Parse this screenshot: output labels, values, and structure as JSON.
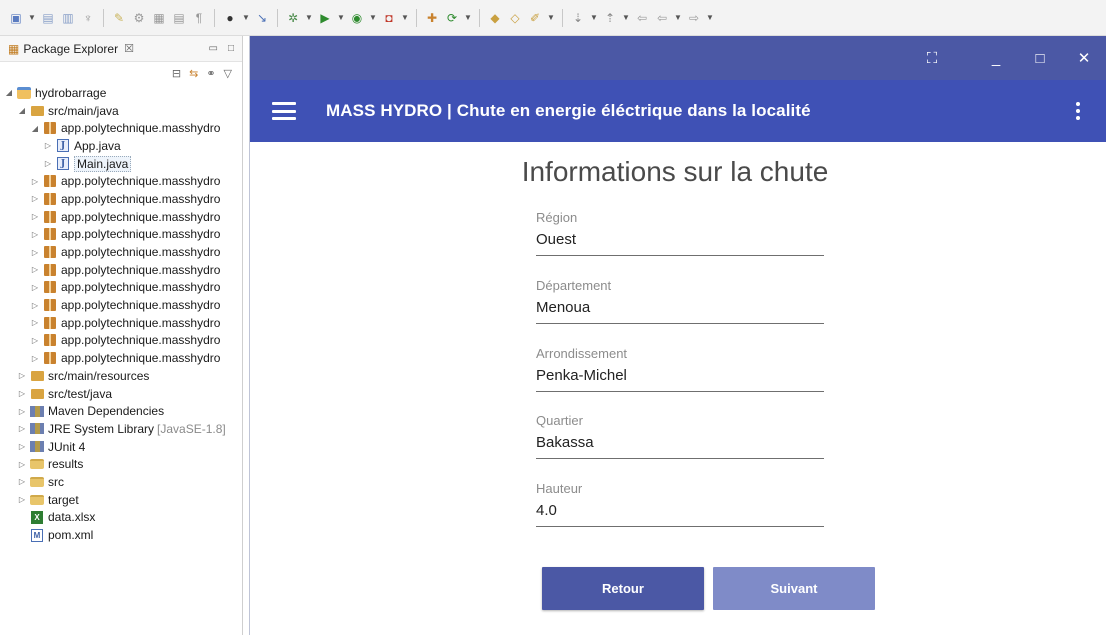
{
  "toolbar": {
    "icons": [
      "new-icon",
      "save-icon",
      "save-all-icon",
      "pin-icon",
      "edit-icon",
      "debug-icon",
      "terminal-icon",
      "doc-icon",
      "paragraph-icon",
      "profile-icon",
      "link-icon",
      "bug-icon",
      "run-icon",
      "coverage-icon",
      "external-tools-icon",
      "new-java-icon",
      "refresh-icon",
      "open-icon",
      "folder-icon",
      "pen-icon",
      "next-annotation-icon",
      "prev-annotation-icon",
      "back-icon",
      "forward-icon"
    ]
  },
  "explorer": {
    "title": "Package Explorer",
    "close": "☒",
    "tree": [
      {
        "depth": 0,
        "twisty": "◢",
        "icon": "proj",
        "label": "hydrobarrage"
      },
      {
        "depth": 1,
        "twisty": "◢",
        "icon": "src",
        "label": "src/main/java"
      },
      {
        "depth": 2,
        "twisty": "◢",
        "icon": "pkg",
        "label": "app.polytechnique.masshydro"
      },
      {
        "depth": 3,
        "twisty": "▷",
        "icon": "java",
        "label": "App.java"
      },
      {
        "depth": 3,
        "twisty": "▷",
        "icon": "java",
        "label": "Main.java",
        "selected": true
      },
      {
        "depth": 2,
        "twisty": "▷",
        "icon": "pkg",
        "label": "app.polytechnique.masshydro"
      },
      {
        "depth": 2,
        "twisty": "▷",
        "icon": "pkg",
        "label": "app.polytechnique.masshydro"
      },
      {
        "depth": 2,
        "twisty": "▷",
        "icon": "pkg",
        "label": "app.polytechnique.masshydro"
      },
      {
        "depth": 2,
        "twisty": "▷",
        "icon": "pkg",
        "label": "app.polytechnique.masshydro"
      },
      {
        "depth": 2,
        "twisty": "▷",
        "icon": "pkg",
        "label": "app.polytechnique.masshydro"
      },
      {
        "depth": 2,
        "twisty": "▷",
        "icon": "pkg",
        "label": "app.polytechnique.masshydro"
      },
      {
        "depth": 2,
        "twisty": "▷",
        "icon": "pkg",
        "label": "app.polytechnique.masshydro"
      },
      {
        "depth": 2,
        "twisty": "▷",
        "icon": "pkg",
        "label": "app.polytechnique.masshydro"
      },
      {
        "depth": 2,
        "twisty": "▷",
        "icon": "pkg",
        "label": "app.polytechnique.masshydro"
      },
      {
        "depth": 2,
        "twisty": "▷",
        "icon": "pkg",
        "label": "app.polytechnique.masshydro"
      },
      {
        "depth": 2,
        "twisty": "▷",
        "icon": "pkg",
        "label": "app.polytechnique.masshydro"
      },
      {
        "depth": 1,
        "twisty": "▷",
        "icon": "src",
        "label": "src/main/resources"
      },
      {
        "depth": 1,
        "twisty": "▷",
        "icon": "src",
        "label": "src/test/java"
      },
      {
        "depth": 1,
        "twisty": "▷",
        "icon": "lib",
        "label": "Maven Dependencies"
      },
      {
        "depth": 1,
        "twisty": "▷",
        "icon": "lib",
        "label": "JRE System Library",
        "suffix": "[JavaSE-1.8]"
      },
      {
        "depth": 1,
        "twisty": "▷",
        "icon": "lib",
        "label": "JUnit 4"
      },
      {
        "depth": 1,
        "twisty": "▷",
        "icon": "folder",
        "label": "results"
      },
      {
        "depth": 1,
        "twisty": "▷",
        "icon": "folder",
        "label": "src"
      },
      {
        "depth": 1,
        "twisty": "▷",
        "icon": "folder",
        "label": "target"
      },
      {
        "depth": 1,
        "twisty": "",
        "icon": "xls",
        "label": "data.xlsx"
      },
      {
        "depth": 1,
        "twisty": "",
        "icon": "pom",
        "label": "pom.xml"
      }
    ]
  },
  "app": {
    "title": "MASS HYDRO | Chute en energie éléctrique dans la localité",
    "page_title": "Informations sur la chute",
    "fields": [
      {
        "label": "Région",
        "value": "Ouest"
      },
      {
        "label": "Département",
        "value": "Menoua"
      },
      {
        "label": "Arrondissement",
        "value": "Penka-Michel"
      },
      {
        "label": "Quartier",
        "value": "Bakassa"
      },
      {
        "label": "Hauteur",
        "value": "4.0"
      }
    ],
    "back_label": "Retour",
    "next_label": "Suivant",
    "colors": {
      "titlebar": "#4b58a5",
      "appbar": "#3f51b5",
      "primary_button": "#4b58a5",
      "secondary_button": "#7f8bc8"
    }
  }
}
